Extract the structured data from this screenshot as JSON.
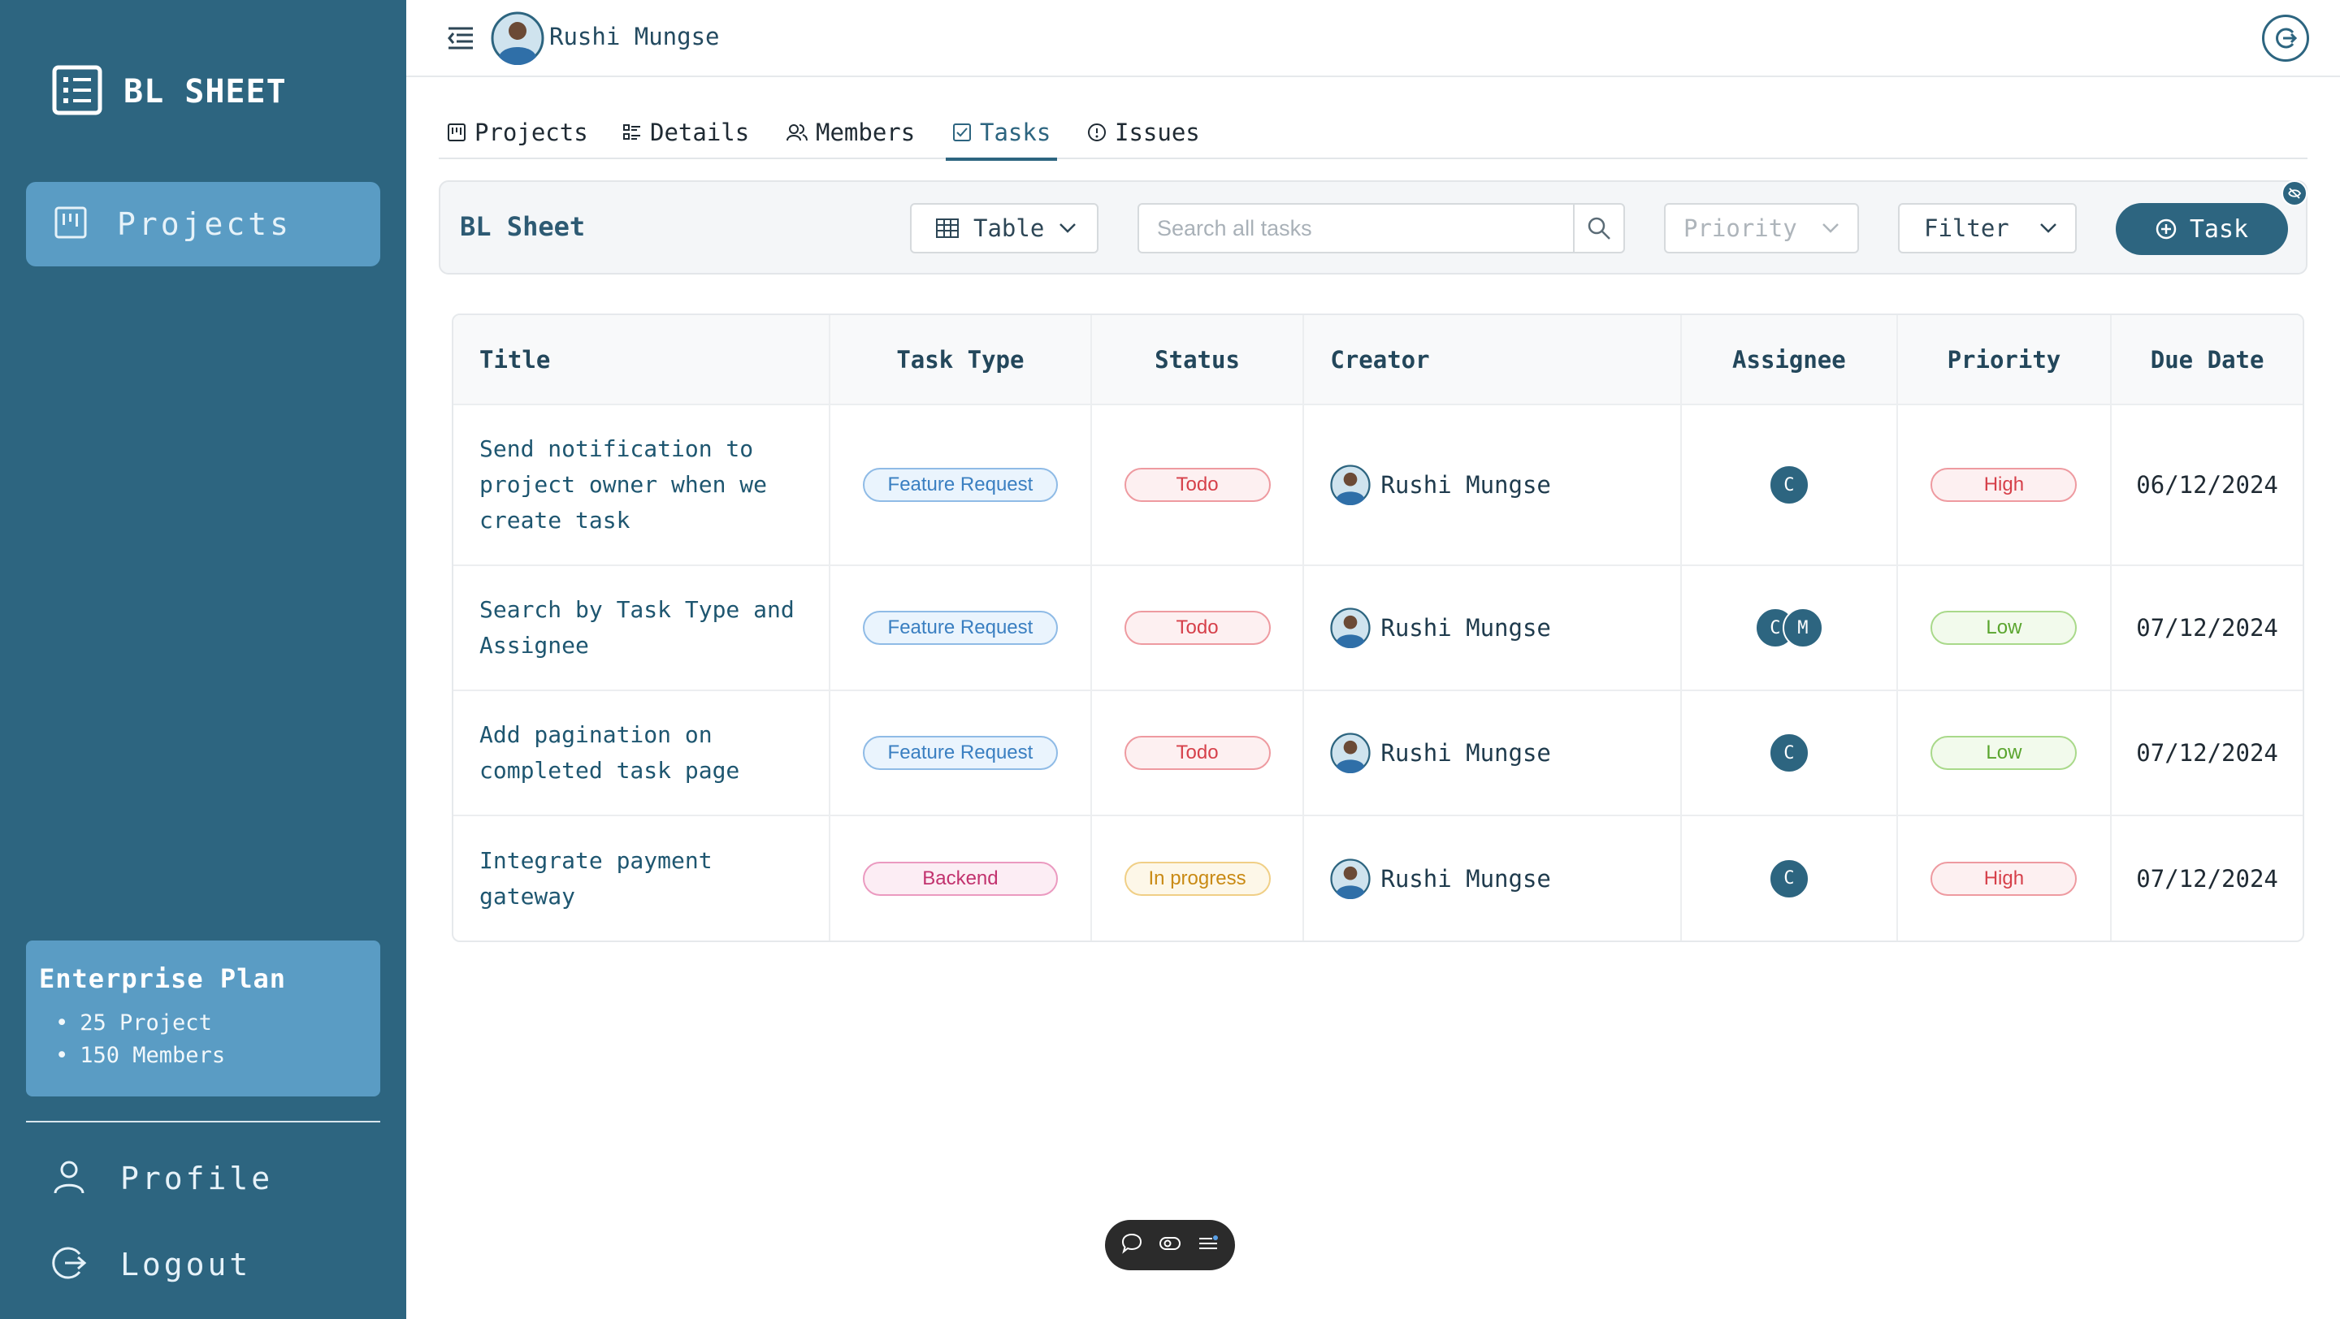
{
  "sidebar": {
    "brand": "BL SHEET",
    "nav_projects": "Projects",
    "plan": {
      "title": "Enterprise Plan",
      "items": [
        "25 Project",
        "150 Members"
      ]
    },
    "profile": "Profile",
    "logout": "Logout"
  },
  "topbar": {
    "user_name": "Rushi Mungse"
  },
  "tabs": [
    {
      "label": "Projects",
      "icon": "board-icon"
    },
    {
      "label": "Details",
      "icon": "details-icon"
    },
    {
      "label": "Members",
      "icon": "members-icon"
    },
    {
      "label": "Tasks",
      "icon": "checkbox-icon",
      "active": true
    },
    {
      "label": "Issues",
      "icon": "info-circle-icon"
    }
  ],
  "toolbar": {
    "title": "BL Sheet",
    "view_label": "Table",
    "search_placeholder": "Search all tasks",
    "priority_label": "Priority",
    "filter_label": "Filter",
    "add_task_label": "Task"
  },
  "table": {
    "columns": [
      "Title",
      "Task Type",
      "Status",
      "Creator",
      "Assignee",
      "Priority",
      "Due Date"
    ],
    "rows": [
      {
        "title": "Send notification to project owner when we create task",
        "task_type": "Feature Request",
        "status": "Todo",
        "creator": "Rushi Mungse",
        "assignees": [
          "C"
        ],
        "priority": "High",
        "due_date": "06/12/2024"
      },
      {
        "title": "Search by Task Type and Assignee",
        "task_type": "Feature Request",
        "status": "Todo",
        "creator": "Rushi Mungse",
        "assignees": [
          "C",
          "M"
        ],
        "priority": "Low",
        "due_date": "07/12/2024"
      },
      {
        "title": "Add pagination on completed task page",
        "task_type": "Feature Request",
        "status": "Todo",
        "creator": "Rushi Mungse",
        "assignees": [
          "C"
        ],
        "priority": "Low",
        "due_date": "07/12/2024"
      },
      {
        "title": "Integrate payment gateway",
        "task_type": "Backend",
        "status": "In progress",
        "creator": "Rushi Mungse",
        "assignees": [
          "C"
        ],
        "priority": "High",
        "due_date": "07/12/2024"
      }
    ]
  },
  "colors": {
    "sidebar_bg": "#2d6580",
    "accent": "#2d6580",
    "nav_active": "#5a9cc4",
    "feature_request": "#3a7fc1",
    "backend": "#c2326e",
    "todo": "#d6404a",
    "in_progress": "#c98a14",
    "high": "#d6404a",
    "low": "#5aa52e"
  }
}
